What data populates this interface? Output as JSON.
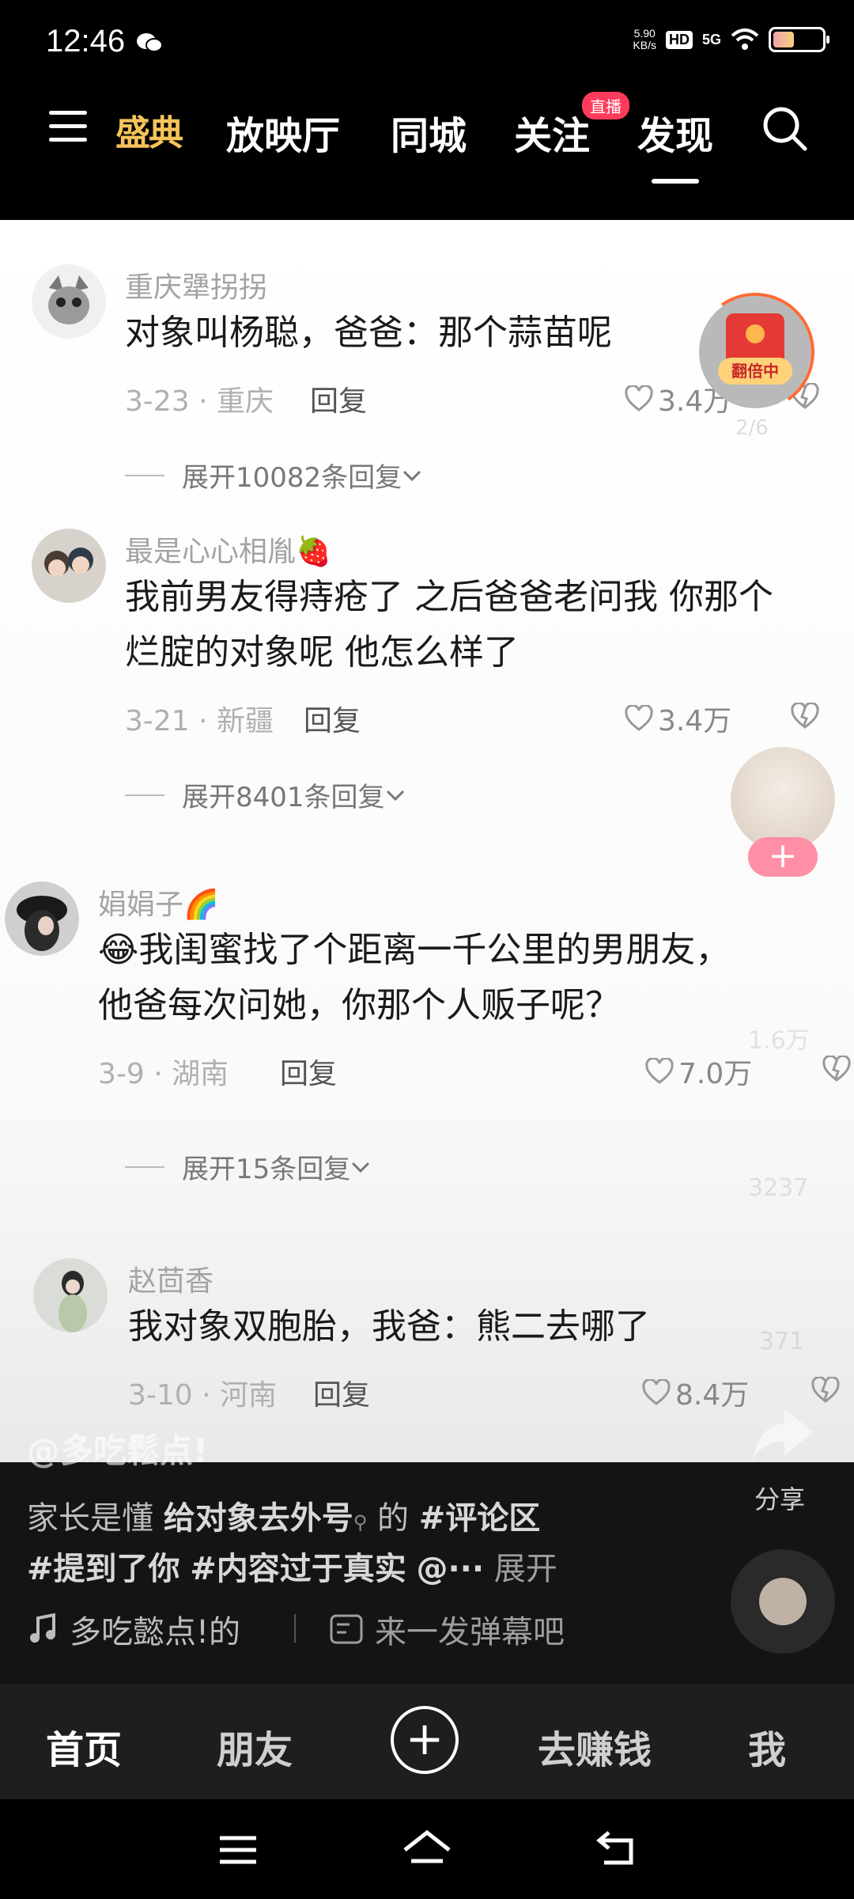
{
  "status_bar": {
    "time": "12:46",
    "net_speed": "5.90",
    "net_speed_unit": "KB/s",
    "hd": "HD",
    "network": "5G"
  },
  "top_nav": {
    "logo": "盛典",
    "tabs": [
      "放映厅",
      "同城",
      "关注",
      "发现"
    ],
    "live_badge": "直播",
    "active_tab": "发现"
  },
  "floating": {
    "red_packet_label": "翻倍中",
    "red_packet_progress": "2/6",
    "follow_plus": "+"
  },
  "comments": [
    {
      "username": "重庆犟拐拐",
      "text": "对象叫杨聪，爸爸：那个蒜苗呢",
      "meta": "3-23 · 重庆",
      "reply": "回复",
      "likes": "3.4万",
      "expand": "展开10082条回复"
    },
    {
      "username": "最是心心相胤🍓",
      "text_line1": "我前男友得痔疮了 之后爸爸老问我 你那个",
      "text_line2": "烂腚的对象呢 他怎么样了",
      "meta": "3-21 · 新疆",
      "reply": "回复",
      "likes": "3.4万",
      "expand": "展开8401条回复"
    },
    {
      "username": "娟娟子🌈",
      "text_line1": "😂我闺蜜找了个距离一千公里的男朋友，",
      "text_line2": "他爸每次问她，你那个人贩子呢？",
      "meta": "3-9 · 湖南",
      "reply": "回复",
      "likes": "7.0万",
      "expand": "展开15条回复"
    },
    {
      "username": "赵茴香",
      "text": "我对象双胞胎，我爸：熊二去哪了",
      "meta": "3-10 · 河南",
      "reply": "回复",
      "likes": "8.4万"
    }
  ],
  "ghost_counts": [
    "1.6万",
    "3237",
    "371"
  ],
  "video": {
    "author": "@多吃鬆点!",
    "desc_prefix": "家长是懂",
    "desc_topic": "给对象去外号",
    "desc_mid": "的",
    "desc_tag1": "#评论区",
    "desc_tag2": "#提到了你",
    "desc_tag3": "#内容过于真实",
    "desc_more": "@···",
    "desc_expand": "展开",
    "music": "多吃懿点!的",
    "danmu": "来一发弹幕吧",
    "share": "分享"
  },
  "bottom_nav": {
    "home": "首页",
    "friends": "朋友",
    "plus": "+",
    "earn": "去赚钱",
    "me": "我"
  }
}
